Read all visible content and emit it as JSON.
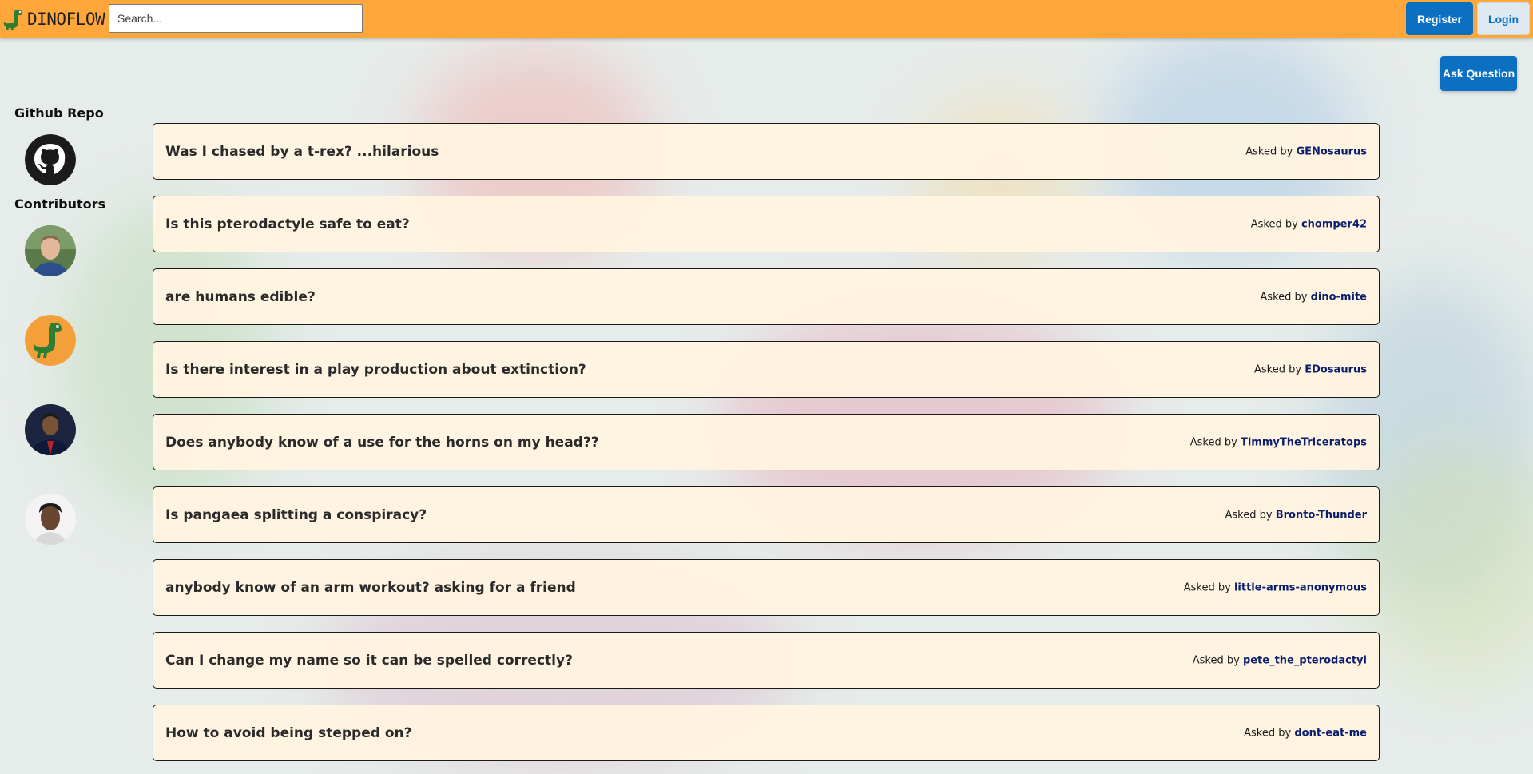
{
  "header": {
    "logo_text": "DINOFLOW",
    "search_placeholder": "Search...",
    "register_label": "Register",
    "login_label": "Login"
  },
  "ask_question_label": "Ask Question",
  "sidebar": {
    "github_heading": "Github Repo",
    "contributors_heading": "Contributors",
    "contributors": [
      {
        "icon": "contributor-photo-1"
      },
      {
        "icon": "dinosaur-avatar"
      },
      {
        "icon": "contributor-photo-3"
      },
      {
        "icon": "contributor-photo-4"
      }
    ]
  },
  "questions": [
    {
      "title": "Was I chased by a t-rex? ...hilarious",
      "asked_by_prefix": "Asked by",
      "author": "GENosaurus"
    },
    {
      "title": "Is this pterodactyle safe to eat?",
      "asked_by_prefix": "Asked by",
      "author": "chomper42"
    },
    {
      "title": "are humans edible?",
      "asked_by_prefix": "Asked by",
      "author": "dino-mite"
    },
    {
      "title": "Is there interest in a play production about extinction?",
      "asked_by_prefix": "Asked by",
      "author": "EDosaurus"
    },
    {
      "title": "Does anybody know of a use for the horns on my head??",
      "asked_by_prefix": "Asked by",
      "author": "TimmyTheTriceratops"
    },
    {
      "title": "Is pangaea splitting a conspiracy?",
      "asked_by_prefix": "Asked by",
      "author": "Bronto-Thunder"
    },
    {
      "title": "anybody know of an arm workout? asking for a friend",
      "asked_by_prefix": "Asked by",
      "author": "little-arms-anonymous"
    },
    {
      "title": "Can I change my name so it can be spelled correctly?",
      "asked_by_prefix": "Asked by",
      "author": "pete_the_pterodactyl"
    },
    {
      "title": "How to avoid being stepped on?",
      "asked_by_prefix": "Asked by",
      "author": "dont-eat-me"
    }
  ],
  "colors": {
    "header_bg": "#ffa73a",
    "primary_button": "#0b6fc2",
    "card_bg": "#fff4e0",
    "author_link": "#0b1e6e"
  }
}
